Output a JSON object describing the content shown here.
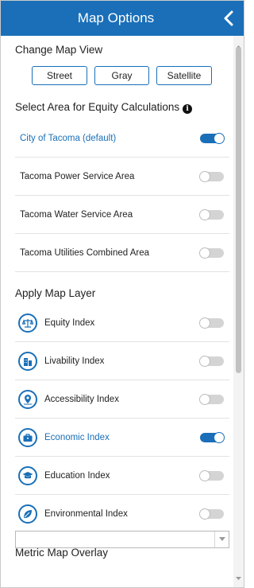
{
  "header": {
    "title": "Map Options",
    "back_icon": "chevron-left-icon"
  },
  "map_view": {
    "title": "Change Map View",
    "buttons": [
      "Street",
      "Gray",
      "Satellite"
    ]
  },
  "equity_area": {
    "title": "Select Area for Equity Calculations",
    "info_icon": "i",
    "items": [
      {
        "label": "City of Tacoma (default)",
        "on": true
      },
      {
        "label": "Tacoma Power Service Area",
        "on": false
      },
      {
        "label": "Tacoma Water Service Area",
        "on": false
      },
      {
        "label": "Tacoma Utilities Combined Area",
        "on": false
      }
    ]
  },
  "map_layer": {
    "title": "Apply Map Layer",
    "items": [
      {
        "label": "Equity Index",
        "icon": "scales-icon",
        "on": false
      },
      {
        "label": "Livability Index",
        "icon": "buildings-icon",
        "on": false
      },
      {
        "label": "Accessibility Index",
        "icon": "location-pin-icon",
        "on": false
      },
      {
        "label": "Economic Index",
        "icon": "briefcase-icon",
        "on": true
      },
      {
        "label": "Education Index",
        "icon": "graduation-cap-icon",
        "on": false
      },
      {
        "label": "Environmental Index",
        "icon": "leaf-icon",
        "on": false
      }
    ]
  },
  "metric_overlay": {
    "title": "Metric Map Overlay",
    "value": ""
  },
  "colors": {
    "accent": "#1a6fb8",
    "toggle_off": "#d4d4d4",
    "divider": "#e2e2e2"
  }
}
